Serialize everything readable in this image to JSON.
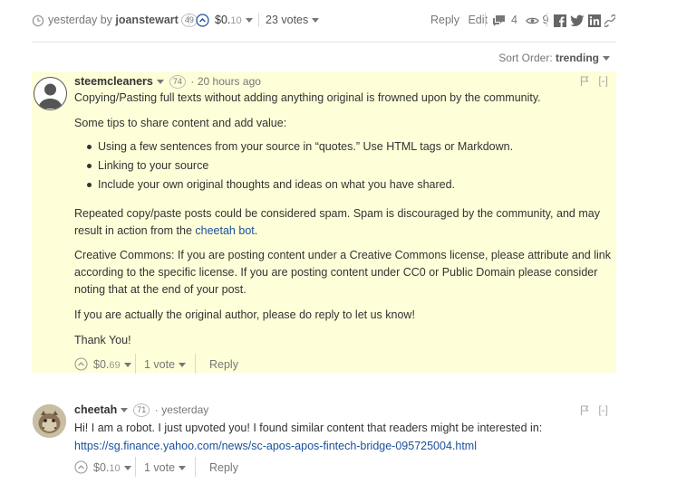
{
  "post_bar": {
    "timestamp": "yesterday",
    "by_label": "by",
    "author": "joanstewart",
    "reputation": "49",
    "payout_dollars": "$0.",
    "payout_cents": "10",
    "votes": "23 votes",
    "reply": "Reply",
    "edit": "Edit",
    "comment_count": "4",
    "views": "9"
  },
  "sort": {
    "label": "Sort Order:",
    "value": "trending"
  },
  "comments": [
    {
      "author": "steemcleaners",
      "reputation": "74",
      "time": "20 hours ago",
      "collapse": "[-]",
      "p1": "Copying/Pasting full texts without adding anything original is frowned upon by the community.",
      "p2": "Some tips to share content and add value:",
      "tips": [
        "Using a few sentences from your source in “quotes.” Use HTML tags or Markdown.",
        "Linking to your source",
        "Include your own original thoughts and ideas on what you have shared."
      ],
      "p3": "Repeated copy/paste posts could be considered spam. Spam is discouraged by the community, and may result in action from the",
      "p3_link": "cheetah bot",
      "p3_end": ".",
      "p4": "Creative Commons: If you are posting content under a Creative Commons license, please attribute and link according to the specific license. If you are posting content under CC0 or Public Domain please consider noting that at the end of your post.",
      "p5": "If you are actually the original author, please do reply to let us know!",
      "p6": "Thank You!",
      "payout_dollars": "$0.",
      "payout_cents": "69",
      "votes": "1 vote",
      "reply": "Reply"
    },
    {
      "author": "cheetah",
      "reputation": "71",
      "time": "yesterday",
      "collapse": "[-]",
      "p1": "Hi! I am a robot. I just upvoted you! I found similar content that readers might be interested in:",
      "link": "https://sg.finance.yahoo.com/news/sc-apos-apos-fintech-bridge-095725004.html",
      "payout_dollars": "$0.",
      "payout_cents": "10",
      "votes": "1 vote",
      "reply": "Reply"
    }
  ]
}
